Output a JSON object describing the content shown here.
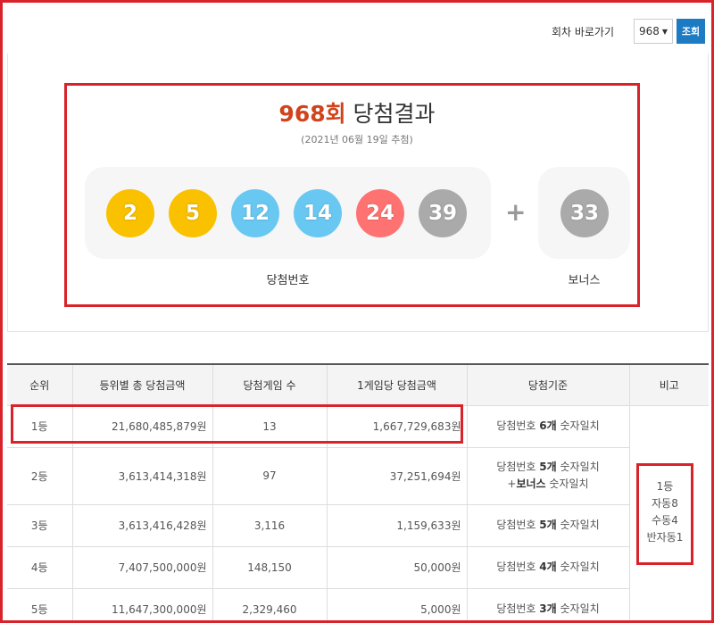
{
  "toolbar": {
    "round_label": "회차 바로가기",
    "round_value": "968",
    "go_label": "조회"
  },
  "result": {
    "round": "968회",
    "title_suffix": " 당첨결과",
    "draw_date": "(2021년 06월 19일 추첨)",
    "winning_label": "당첨번호",
    "bonus_label": "보너스",
    "plus": "+",
    "numbers": [
      {
        "value": "2",
        "color": "#f9c100"
      },
      {
        "value": "5",
        "color": "#f9c100"
      },
      {
        "value": "12",
        "color": "#69c8f2"
      },
      {
        "value": "14",
        "color": "#69c8f2"
      },
      {
        "value": "24",
        "color": "#ff7272"
      },
      {
        "value": "39",
        "color": "#aaaaaa"
      }
    ],
    "bonus": {
      "value": "33",
      "color": "#aaaaaa"
    }
  },
  "table": {
    "headers": [
      "순위",
      "등위별 총 당첨금액",
      "당첨게임 수",
      "1게임당 당첨금액",
      "당첨기준",
      "비고"
    ],
    "rows": [
      {
        "rank": "1등",
        "total": "21,680,485,879원",
        "count": "13",
        "per_game": "1,667,729,683원",
        "crit_pre": "당첨번호 ",
        "crit_bold": "6개",
        "crit_post": " 숫자일치",
        "crit_line2_pre": "",
        "crit_line2_bold": "",
        "crit_line2_post": ""
      },
      {
        "rank": "2등",
        "total": "3,613,414,318원",
        "count": "97",
        "per_game": "37,251,694원",
        "crit_pre": "당첨번호 ",
        "crit_bold": "5개",
        "crit_post": " 숫자일치",
        "crit_line2_pre": "+",
        "crit_line2_bold": "보너스",
        "crit_line2_post": " 숫자일치"
      },
      {
        "rank": "3등",
        "total": "3,613,416,428원",
        "count": "3,116",
        "per_game": "1,159,633원",
        "crit_pre": "당첨번호 ",
        "crit_bold": "5개",
        "crit_post": " 숫자일치",
        "crit_line2_pre": "",
        "crit_line2_bold": "",
        "crit_line2_post": ""
      },
      {
        "rank": "4등",
        "total": "7,407,500,000원",
        "count": "148,150",
        "per_game": "50,000원",
        "crit_pre": "당첨번호 ",
        "crit_bold": "4개",
        "crit_post": " 숫자일치",
        "crit_line2_pre": "",
        "crit_line2_bold": "",
        "crit_line2_post": ""
      },
      {
        "rank": "5등",
        "total": "11,647,300,000원",
        "count": "2,329,460",
        "per_game": "5,000원",
        "crit_pre": "당첨번호 ",
        "crit_bold": "3개",
        "crit_post": " 숫자일치",
        "crit_line2_pre": "",
        "crit_line2_bold": "",
        "crit_line2_post": ""
      }
    ],
    "note_lines": [
      "1등",
      "자동8",
      "수동4",
      "반자동1"
    ]
  }
}
